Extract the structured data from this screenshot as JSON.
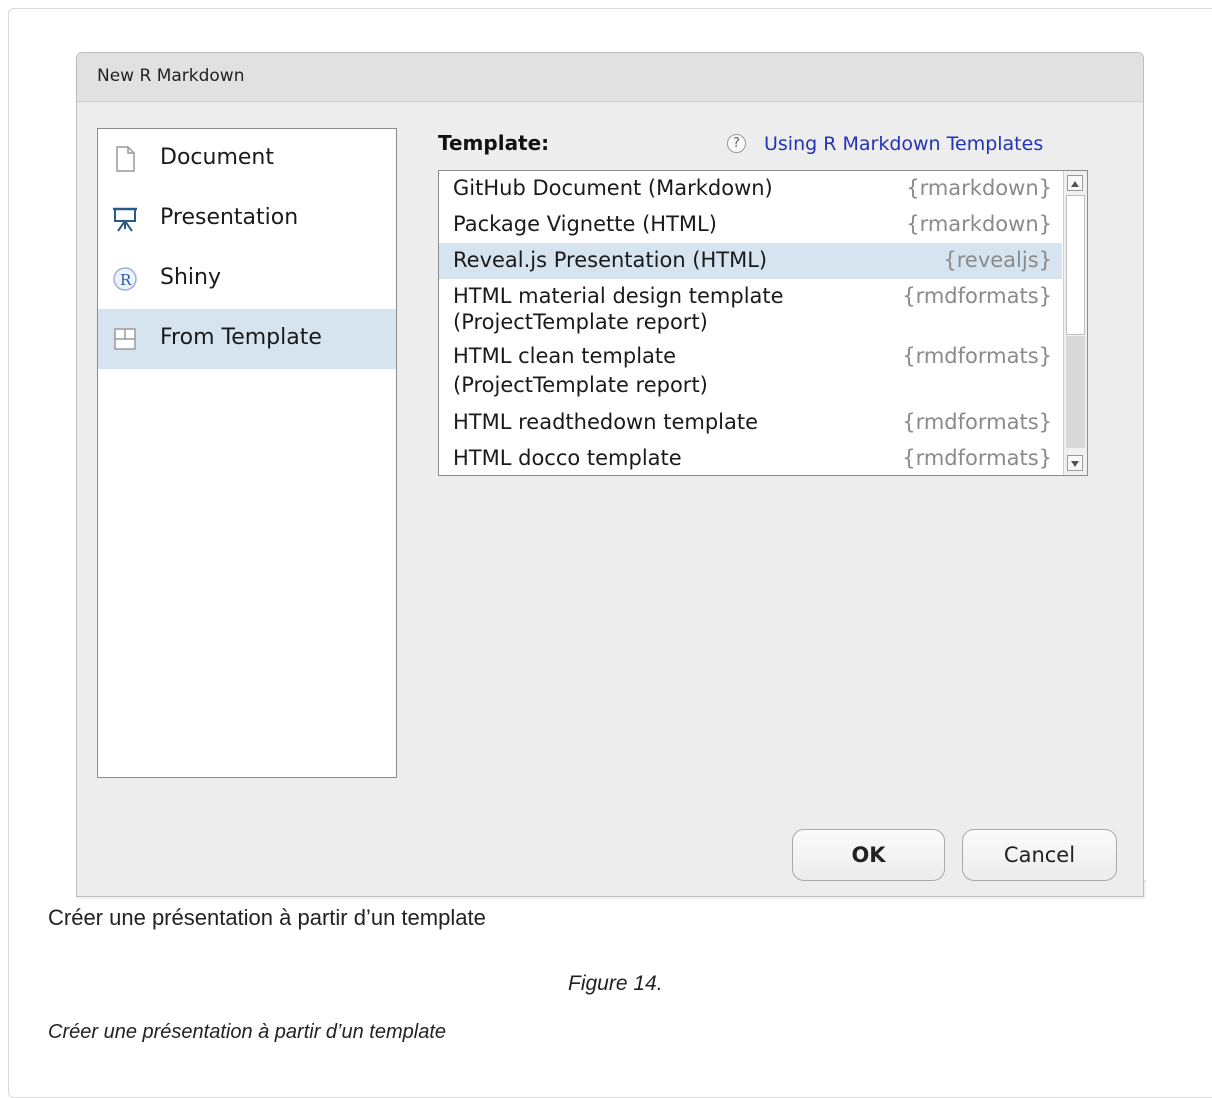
{
  "dialog": {
    "title": "New R Markdown",
    "left_list": [
      {
        "label": "Document",
        "icon": "document-icon",
        "selected": false
      },
      {
        "label": "Presentation",
        "icon": "presentation-icon",
        "selected": false
      },
      {
        "label": "Shiny",
        "icon": "r-logo-icon",
        "selected": false
      },
      {
        "label": "From Template",
        "icon": "template-icon",
        "selected": true
      }
    ],
    "template_label": "Template:",
    "help_link": "Using R Markdown Templates",
    "templates": [
      {
        "name": "GitHub Document (Markdown)",
        "package": "{rmarkdown}"
      },
      {
        "name": "Package Vignette (HTML)",
        "package": "{rmarkdown}"
      },
      {
        "name": "Reveal.js Presentation (HTML)",
        "package": "{revealjs}",
        "selected": true
      },
      {
        "name": "HTML material design template",
        "name2": "(ProjectTemplate report)",
        "package": "{rmdformats}"
      },
      {
        "name": "HTML clean template",
        "name2": "(ProjectTemplate report)",
        "package": "{rmdformats}"
      },
      {
        "name": "HTML readthedown template",
        "package": "{rmdformats}"
      },
      {
        "name": "HTML docco template",
        "package": "{rmdformats}"
      }
    ],
    "ok_label": "OK",
    "cancel_label": "Cancel"
  },
  "caption": "Créer une présentation à partir d’un template",
  "figure_number": "Figure 14.",
  "figure_caption": "Créer une présentation à partir d’un template",
  "colors": {
    "selection": "#d6e4f0",
    "link": "#2233b8",
    "dialog_bg": "#ededed"
  }
}
